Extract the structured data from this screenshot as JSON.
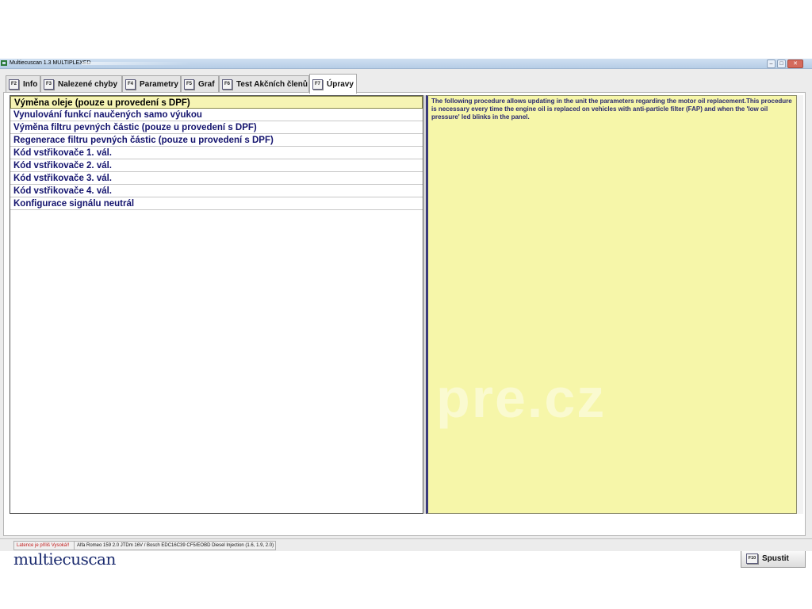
{
  "window": {
    "title": "Multiecuscan 1.3 MULTIPLEXED",
    "controls": {
      "minimize": "–",
      "maximize": "□",
      "close": "✕"
    }
  },
  "tabs": [
    {
      "key": "F2",
      "label": "Info"
    },
    {
      "key": "F3",
      "label": "Nalezené chyby"
    },
    {
      "key": "F4",
      "label": "Parametry"
    },
    {
      "key": "F5",
      "label": "Graf"
    },
    {
      "key": "F6",
      "label": "Test Akčních členů"
    },
    {
      "key": "F7",
      "label": "Úpravy",
      "active": true
    }
  ],
  "procedures": {
    "selected_index": 0,
    "items": [
      "Výměna oleje (pouze u provedení s DPF)",
      "Vynulování funkcí naučených samo výukou",
      "Výměna filtru pevných částic (pouze u provedení s DPF)",
      "Regenerace filtru pevných částic (pouze u provedení s DPF)",
      "Kód vstřikovače 1. vál.",
      "Kód vstřikovače 2. vál.",
      "Kód vstřikovače 3. vál.",
      "Kód vstřikovače 4. vál.",
      "Konfigurace signálu neutrál"
    ]
  },
  "description": "The following procedure allows updating in the unit the parameters regarding the motor oil replacement.This procedure is necessary every time the engine oil is replaced on vehicles with anti-particle filter (FAP) and when the 'low oil pressure' led blinks in the panel.",
  "watermark": "pre.cz",
  "logo": "multiecuscan",
  "run_button": {
    "key": "F10",
    "label": "Spustit"
  },
  "status_bar": {
    "latency": "Latence je příliš Vysoká!!",
    "vehicle": "Alfa Romeo 159 2.0 JTDm 16V / Bosch EDC16C39 CF5/EOBD Diesel Injection (1.6, 1.9, 2.0)"
  },
  "colors": {
    "selected_row": "#f6f4b4",
    "description_bg": "#f6f6a9",
    "item_text": "#14146e",
    "warning_text": "#c01818"
  }
}
